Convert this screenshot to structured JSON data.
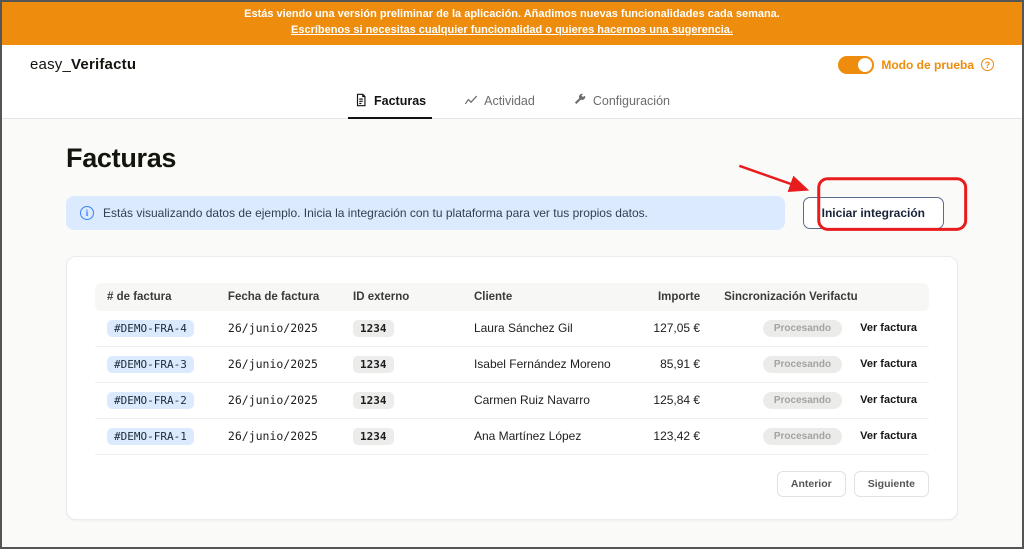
{
  "banner": {
    "line1": "Estás viendo una versión preliminar de la aplicación. Añadimos nuevas funcionalidades cada semana.",
    "line2": "Escríbenos si necesitas cualquier funcionalidad o quieres hacernos una sugerencia."
  },
  "header": {
    "logo_prefix": "easy_",
    "logo_suffix": "Verifactu",
    "test_mode_label": "Modo de prueba",
    "help_glyph": "?"
  },
  "nav": {
    "tabs": [
      {
        "label": "Facturas",
        "active": true
      },
      {
        "label": "Actividad",
        "active": false
      },
      {
        "label": "Configuración",
        "active": false
      }
    ]
  },
  "main": {
    "title": "Facturas",
    "info_icon_glyph": "i",
    "info_banner": "Estás visualizando datos de ejemplo. Inicia la integración con tu plataforma para ver tus propios datos.",
    "cta_button": "Iniciar integración"
  },
  "table": {
    "headers": [
      "# de factura",
      "Fecha de factura",
      "ID externo",
      "Cliente",
      "Importe",
      "Sincronización Verifactu"
    ],
    "rows": [
      {
        "invoice": "#DEMO-FRA-4",
        "date": "26/junio/2025",
        "external_id": "1234",
        "client": "Laura Sánchez Gil",
        "amount": "127,05 €",
        "status": "Procesando",
        "action": "Ver factura"
      },
      {
        "invoice": "#DEMO-FRA-3",
        "date": "26/junio/2025",
        "external_id": "1234",
        "client": "Isabel Fernández Moreno",
        "amount": "85,91 €",
        "status": "Procesando",
        "action": "Ver factura"
      },
      {
        "invoice": "#DEMO-FRA-2",
        "date": "26/junio/2025",
        "external_id": "1234",
        "client": "Carmen Ruiz Navarro",
        "amount": "125,84 €",
        "status": "Procesando",
        "action": "Ver factura"
      },
      {
        "invoice": "#DEMO-FRA-1",
        "date": "26/junio/2025",
        "external_id": "1234",
        "client": "Ana Martínez López",
        "amount": "123,42 €",
        "status": "Procesando",
        "action": "Ver factura"
      }
    ],
    "pagination": {
      "prev": "Anterior",
      "next": "Siguiente"
    }
  },
  "colors": {
    "accent": "#ED8C0D",
    "red": "#E81C1C",
    "info_bg": "#DBEAFE",
    "blue_badge": "#DBEAFE"
  }
}
